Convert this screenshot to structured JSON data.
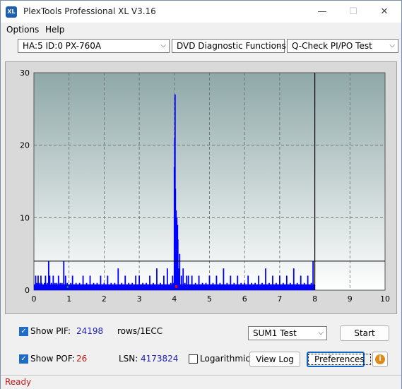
{
  "app": {
    "title": "PlexTools Professional XL V3.16",
    "icon_label": "XL",
    "window_controls": {
      "minimize": "—",
      "maximize": "☐",
      "close": "✕"
    }
  },
  "menu": {
    "items": [
      {
        "label": "Options"
      },
      {
        "label": "Help"
      }
    ]
  },
  "toolbar": {
    "drive": "HA:5 ID:0  PX-760A",
    "function": "DVD Diagnostic Functions",
    "test": "Q-Check PI/PO Test"
  },
  "chart_data": {
    "type": "bar",
    "xlim": [
      0,
      10
    ],
    "ylim": [
      0,
      30
    ],
    "x_ticks": [
      "0",
      "1",
      "2",
      "3",
      "4",
      "5",
      "6",
      "7",
      "8",
      "9",
      "10"
    ],
    "y_ticks": [
      "0",
      "10",
      "20",
      "30"
    ],
    "threshold": 4,
    "data_end_x": 8.0,
    "grid": true,
    "colors": {
      "bars": "#0000ff",
      "plot_bg_top": "#8fa8a8",
      "plot_bg_bottom": "#ffffff",
      "threshold": "#000000",
      "pof": "#ff0000"
    },
    "series": [
      {
        "name": "PIF",
        "x": [
          0.05,
          0.08,
          0.12,
          0.15,
          0.2,
          0.22,
          0.3,
          0.33,
          0.38,
          0.42,
          0.45,
          0.5,
          0.55,
          0.6,
          0.65,
          0.7,
          0.75,
          0.8,
          0.85,
          0.9,
          0.95,
          1.05,
          1.1,
          1.2,
          1.3,
          1.4,
          1.5,
          1.6,
          1.7,
          1.8,
          1.9,
          2.0,
          2.1,
          2.2,
          2.3,
          2.4,
          2.5,
          2.6,
          2.7,
          2.8,
          2.9,
          3.0,
          3.1,
          3.2,
          3.3,
          3.4,
          3.5,
          3.6,
          3.7,
          3.8,
          3.9,
          3.95,
          3.97,
          4.0,
          4.01,
          4.02,
          4.03,
          4.04,
          4.05,
          4.06,
          4.07,
          4.08,
          4.09,
          4.1,
          4.12,
          4.15,
          4.2,
          4.25,
          4.3,
          4.35,
          4.4,
          4.5,
          4.6,
          4.7,
          4.8,
          4.9,
          5.0,
          5.1,
          5.2,
          5.3,
          5.4,
          5.5,
          5.6,
          5.7,
          5.8,
          5.9,
          6.0,
          6.1,
          6.2,
          6.3,
          6.4,
          6.5,
          6.6,
          6.7,
          6.8,
          6.9,
          7.0,
          7.1,
          7.2,
          7.3,
          7.4,
          7.5,
          7.6,
          7.7,
          7.8,
          7.9,
          7.95
        ],
        "values": [
          2,
          1,
          2,
          1,
          2,
          1,
          1,
          2,
          1,
          4,
          2,
          1,
          2,
          1,
          1,
          2,
          1,
          1,
          4,
          2,
          1,
          1,
          2,
          1,
          1,
          2,
          1,
          2,
          1,
          1,
          2,
          1,
          2,
          1,
          1,
          3,
          1,
          2,
          1,
          1,
          2,
          2,
          1,
          1,
          2,
          1,
          3,
          1,
          2,
          3,
          1,
          2,
          1,
          17,
          21,
          27,
          14,
          9,
          11,
          5,
          10,
          4,
          9,
          7,
          3,
          5,
          2,
          3,
          1,
          2,
          2,
          2,
          1,
          2,
          1,
          1,
          2,
          1,
          2,
          1,
          3,
          1,
          2,
          1,
          2,
          1,
          1,
          2,
          1,
          1,
          2,
          1,
          3,
          1,
          2,
          1,
          2,
          1,
          2,
          1,
          3,
          1,
          2,
          1,
          2,
          1,
          4
        ]
      }
    ]
  },
  "bottom": {
    "show_pif_label": "Show PIF:",
    "pif_value": "24198",
    "units": "rows/1ECC",
    "show_pof_label": "Show POF:",
    "pof_value": "26",
    "lsn_label": "LSN:",
    "lsn_value": "4173824",
    "log_label": "Logarithmic",
    "sum_select": "SUM1 Test",
    "start_label": "Start",
    "view_log_label": "View Log",
    "preferences_label": "Preferences",
    "info_icon": "i"
  },
  "status": {
    "text": "Ready"
  }
}
